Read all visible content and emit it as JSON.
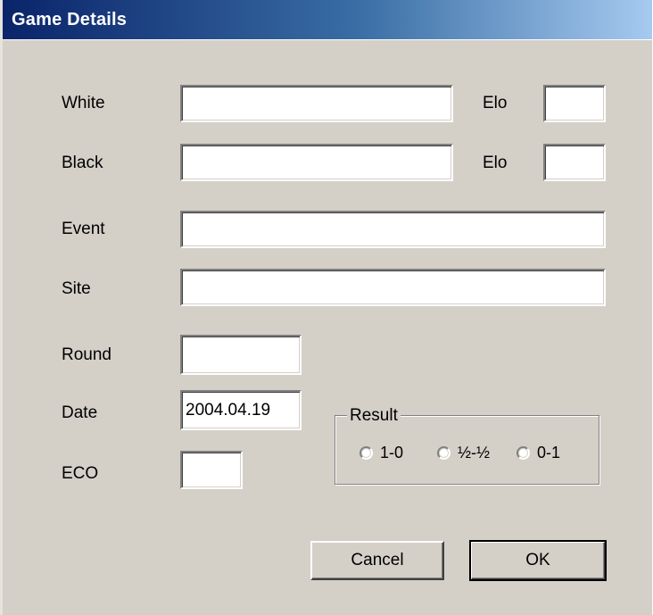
{
  "window": {
    "title": "Game Details"
  },
  "labels": {
    "white": "White",
    "black": "Black",
    "white_elo": "Elo",
    "black_elo": "Elo",
    "event": "Event",
    "site": "Site",
    "round": "Round",
    "date": "Date",
    "eco": "ECO"
  },
  "fields": {
    "white": "",
    "white_elo": "",
    "black": "",
    "black_elo": "",
    "event": "",
    "site": "",
    "round": "",
    "date": "2004.04.19",
    "eco": ""
  },
  "result": {
    "legend": "Result",
    "options": [
      "1-0",
      "½-½",
      "0-1"
    ],
    "selected": null
  },
  "buttons": {
    "cancel": "Cancel",
    "ok": "OK"
  }
}
